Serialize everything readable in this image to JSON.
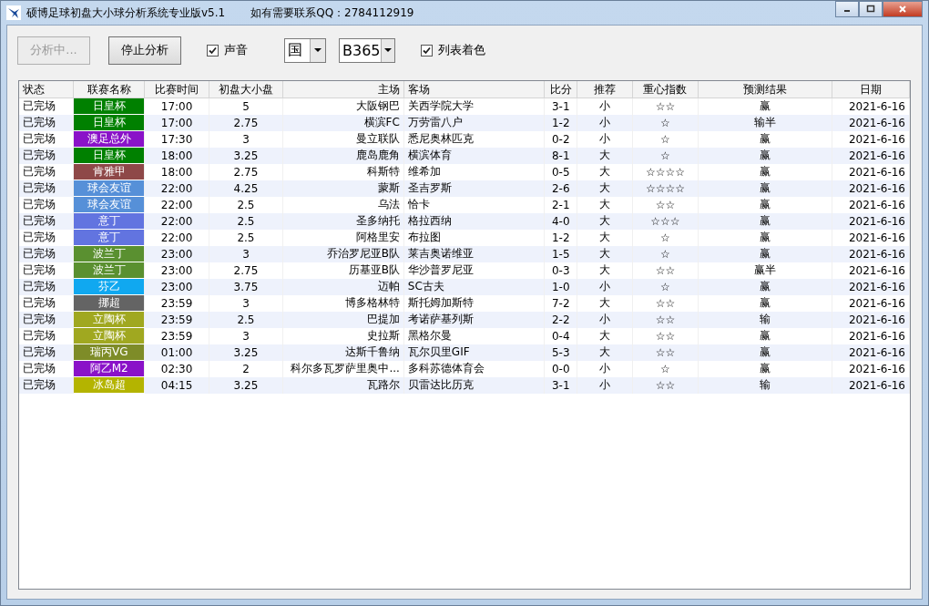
{
  "window": {
    "title": "硕博足球初盘大小球分析系统专业版v5.1",
    "contact": "如有需要联系QQ：2784112919"
  },
  "toolbar": {
    "analyze_button": {
      "label": "分析中...",
      "disabled": true
    },
    "stop_button": {
      "label": "停止分析",
      "disabled": false
    },
    "sound": {
      "label": "声音",
      "checked": true
    },
    "region_select": {
      "value": "国"
    },
    "bookmaker_select": {
      "value": "B365"
    },
    "color_list": {
      "label": "列表着色",
      "checked": true
    }
  },
  "table": {
    "columns": [
      "状态",
      "联赛名称",
      "比赛时间",
      "初盘大小盘",
      "主场",
      "客场",
      "比分",
      "推荐",
      "重心指数",
      "预测结果",
      "日期"
    ],
    "rows": [
      {
        "status": "已完场",
        "league": "日皇杯",
        "color": "#008000",
        "time": "17:00",
        "line": "5",
        "home": "大阪钢巴",
        "away": "关西学院大学",
        "score": "3-1",
        "pick": "小",
        "index": "☆☆",
        "result": "赢",
        "date": "2021-6-16"
      },
      {
        "status": "已完场",
        "league": "日皇杯",
        "color": "#008000",
        "time": "17:00",
        "line": "2.75",
        "home": "横滨FC",
        "away": "万劳雷八户",
        "score": "1-2",
        "pick": "小",
        "index": "☆",
        "result": "输半",
        "date": "2021-6-16"
      },
      {
        "status": "已完场",
        "league": "澳足总外",
        "color": "#8a12c8",
        "time": "17:30",
        "line": "3",
        "home": "曼立联队",
        "away": "悉尼奥林匹克",
        "score": "0-2",
        "pick": "小",
        "index": "☆",
        "result": "赢",
        "date": "2021-6-16"
      },
      {
        "status": "已完场",
        "league": "日皇杯",
        "color": "#008000",
        "time": "18:00",
        "line": "3.25",
        "home": "鹿岛鹿角",
        "away": "横滨体育",
        "score": "8-1",
        "pick": "大",
        "index": "☆",
        "result": "赢",
        "date": "2021-6-16"
      },
      {
        "status": "已完场",
        "league": "肯雅甲",
        "color": "#8e4848",
        "time": "18:00",
        "line": "2.75",
        "home": "科斯特",
        "away": "维希加",
        "score": "0-5",
        "pick": "大",
        "index": "☆☆☆☆",
        "result": "赢",
        "date": "2021-6-16"
      },
      {
        "status": "已完场",
        "league": "球会友谊",
        "color": "#5690d8",
        "time": "22:00",
        "line": "4.25",
        "home": "蒙斯",
        "away": "圣吉罗斯",
        "score": "2-6",
        "pick": "大",
        "index": "☆☆☆☆",
        "result": "赢",
        "date": "2021-6-16"
      },
      {
        "status": "已完场",
        "league": "球会友谊",
        "color": "#5690d8",
        "time": "22:00",
        "line": "2.5",
        "home": "乌法",
        "away": "恰卡",
        "score": "2-1",
        "pick": "大",
        "index": "☆☆",
        "result": "赢",
        "date": "2021-6-16"
      },
      {
        "status": "已完场",
        "league": "意丁",
        "color": "#6274e0",
        "time": "22:00",
        "line": "2.5",
        "home": "圣多纳托",
        "away": "格拉西纳",
        "score": "4-0",
        "pick": "大",
        "index": "☆☆☆",
        "result": "赢",
        "date": "2021-6-16"
      },
      {
        "status": "已完场",
        "league": "意丁",
        "color": "#6274e0",
        "time": "22:00",
        "line": "2.5",
        "home": "阿格里安",
        "away": "布拉图",
        "score": "1-2",
        "pick": "大",
        "index": "☆",
        "result": "赢",
        "date": "2021-6-16"
      },
      {
        "status": "已完场",
        "league": "波兰丁",
        "color": "#5a9030",
        "time": "23:00",
        "line": "3",
        "home": "乔治罗尼亚B队",
        "away": "莱吉奥诺维亚",
        "score": "1-5",
        "pick": "大",
        "index": "☆",
        "result": "赢",
        "date": "2021-6-16"
      },
      {
        "status": "已完场",
        "league": "波兰丁",
        "color": "#5a9030",
        "time": "23:00",
        "line": "2.75",
        "home": "历基亚B队",
        "away": "华沙普罗尼亚",
        "score": "0-3",
        "pick": "大",
        "index": "☆☆",
        "result": "赢半",
        "date": "2021-6-16"
      },
      {
        "status": "已完场",
        "league": "芬乙",
        "color": "#10a8f0",
        "time": "23:00",
        "line": "3.75",
        "home": "迈帕",
        "away": "SC古夫",
        "score": "1-0",
        "pick": "小",
        "index": "☆",
        "result": "赢",
        "date": "2021-6-16"
      },
      {
        "status": "已完场",
        "league": "挪超",
        "color": "#646464",
        "time": "23:59",
        "line": "3",
        "home": "博多格林特",
        "away": "斯托姆加斯特",
        "score": "7-2",
        "pick": "大",
        "index": "☆☆",
        "result": "赢",
        "date": "2021-6-16"
      },
      {
        "status": "已完场",
        "league": "立陶杯",
        "color": "#a0a820",
        "time": "23:59",
        "line": "2.5",
        "home": "巴提加",
        "away": "考诺萨基列斯",
        "score": "2-2",
        "pick": "小",
        "index": "☆☆",
        "result": "输",
        "date": "2021-6-16"
      },
      {
        "status": "已完场",
        "league": "立陶杯",
        "color": "#a0a820",
        "time": "23:59",
        "line": "3",
        "home": "史拉斯",
        "away": "黑格尔曼",
        "score": "0-4",
        "pick": "大",
        "index": "☆☆",
        "result": "赢",
        "date": "2021-6-16"
      },
      {
        "status": "已完场",
        "league": "瑞丙VG",
        "color": "#7e8c28",
        "time": "01:00",
        "line": "3.25",
        "home": "达斯千鲁纳",
        "away": "瓦尔贝里GIF",
        "score": "5-3",
        "pick": "大",
        "index": "☆☆",
        "result": "赢",
        "date": "2021-6-16"
      },
      {
        "status": "已完场",
        "league": "阿乙M2",
        "color": "#8a12c8",
        "time": "02:30",
        "line": "2",
        "home": "科尔多瓦罗萨里奥中...",
        "away": "多科苏德体育会",
        "score": "0-0",
        "pick": "小",
        "index": "☆",
        "result": "赢",
        "date": "2021-6-16"
      },
      {
        "status": "已完场",
        "league": "冰岛超",
        "color": "#b4b400",
        "time": "04:15",
        "line": "3.25",
        "home": "瓦路尔",
        "away": "贝雷达比历克",
        "score": "3-1",
        "pick": "小",
        "index": "☆☆",
        "result": "输",
        "date": "2021-6-16"
      }
    ]
  }
}
